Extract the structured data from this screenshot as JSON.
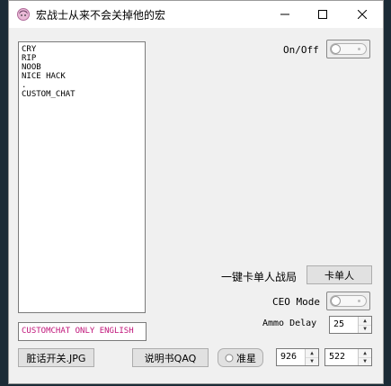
{
  "window": {
    "title": "宏战士从来不会关掉他的宏"
  },
  "list": {
    "items": [
      "CRY",
      "RIP",
      "NOOB",
      "NICE HACK",
      ".",
      "CUSTOM_CHAT"
    ]
  },
  "toggles": {
    "on_off_label": "On/Off",
    "ceo_mode_label": "CEO Mode"
  },
  "one_click": {
    "label": "一键卡单人战局",
    "button": "卡单人"
  },
  "ammo_delay": {
    "label": "Ammo Delay",
    "value": "25"
  },
  "custom_chat": {
    "value": "CUSTOMCHAT ONLY ENGLISH"
  },
  "bottom": {
    "chat_toggle_button": "脏话开关.JPG",
    "manual_button": "说明书QAQ",
    "crosshair_button": "准星",
    "crosshair_x": "926",
    "crosshair_y": "522"
  },
  "colors": {
    "accent_text": "#c0157a",
    "window_bg": "#f0f0f0"
  }
}
